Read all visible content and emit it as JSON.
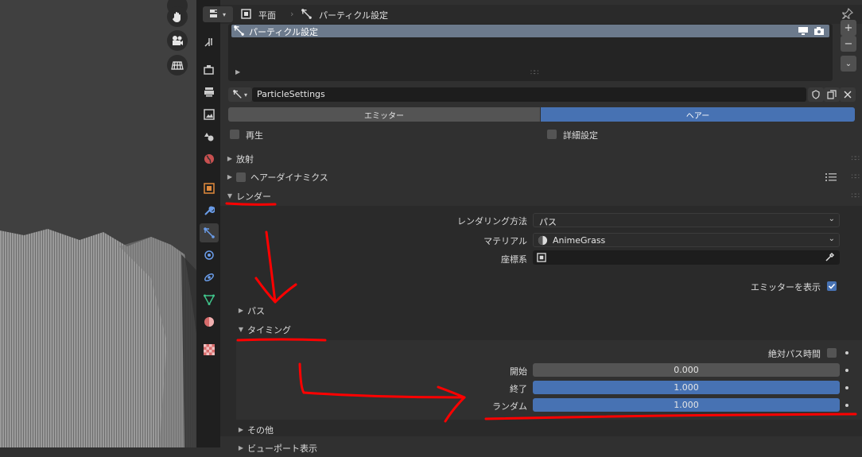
{
  "header": {
    "object_name": "平面",
    "particle_label": "パーティクル設定"
  },
  "particle_slots": {
    "items": [
      "パーティクル設定"
    ],
    "add_label": "+",
    "remove_label": "−"
  },
  "settings": {
    "datablock_name": "ParticleSettings"
  },
  "type_toggle": {
    "emitter": "エミッター",
    "hair": "ヘアー"
  },
  "options": {
    "regrow": "再生",
    "advanced": "詳細設定"
  },
  "panels": {
    "emission": "放射",
    "hair_dynamics": "ヘアーダイナミクス",
    "render": "レンダー",
    "path": "パス",
    "timing": "タイミング",
    "extra": "その他",
    "viewport_display": "ビューポート表示"
  },
  "render": {
    "method_label": "レンダリング方法",
    "method_value": "パス",
    "material_label": "マテリアル",
    "material_value": "AnimeGrass",
    "coord_label": "座標系",
    "coord_value": "",
    "show_emitter_label": "エミッターを表示",
    "show_emitter_checked": true
  },
  "timing": {
    "absolute_path_time_label": "絶対パス時間",
    "absolute_path_time_checked": false,
    "start_label": "開始",
    "start_value": "0.000",
    "start_fraction": 0.0,
    "end_label": "終了",
    "end_value": "1.000",
    "end_fraction": 1.0,
    "random_label": "ランダム",
    "random_value": "1.000",
    "random_fraction": 1.0
  },
  "colors": {
    "accent": "#4772b3",
    "annotation": "#ff0000",
    "panel_bg": "#303030",
    "subpanel_bg": "#2a2a2a"
  }
}
